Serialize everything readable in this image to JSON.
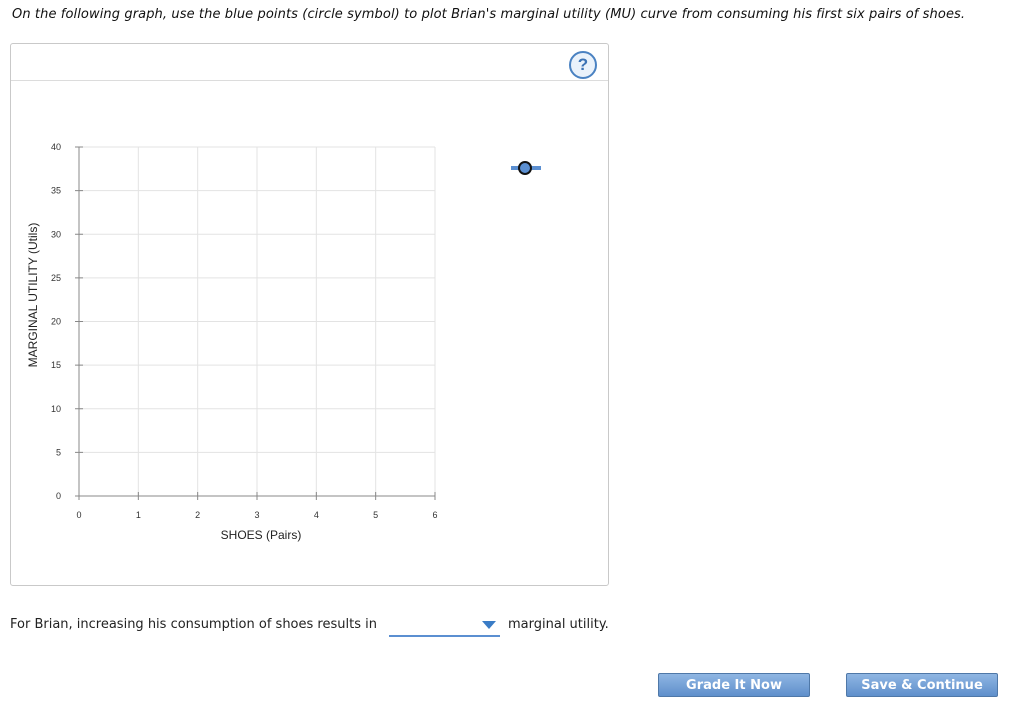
{
  "instruction": "On the following graph, use the blue points (circle symbol) to plot Brian's marginal utility (MU) curve from consuming his first six pairs of shoes.",
  "help_button": {
    "label": "?",
    "icon": "help-question-icon"
  },
  "palette": {
    "accent": "#3a7cc6",
    "point_fill": "#5b8fd1",
    "grid": "#e3e3e3",
    "axis": "#888888"
  },
  "chart_data": {
    "type": "scatter",
    "title": "",
    "xlabel": "SHOES (Pairs)",
    "ylabel": "MARGINAL UTILITY (Utils)",
    "xlim": [
      0,
      6
    ],
    "ylim": [
      0,
      40
    ],
    "x_ticks": [
      "0",
      "1",
      "2",
      "3",
      "4",
      "5",
      "6"
    ],
    "y_ticks": [
      "0",
      "5",
      "10",
      "15",
      "20",
      "25",
      "30",
      "35",
      "40"
    ],
    "grid": true,
    "series": [
      {
        "symbol": "circle",
        "color": "#5b8fd1",
        "points": []
      }
    ],
    "palette_tool": {
      "symbol": "circle",
      "location": "right of plot, top"
    }
  },
  "question": {
    "prefix": "For Brian, increasing his consumption of shoes results in",
    "dropdown_value": "",
    "suffix": "marginal utility."
  },
  "buttons": {
    "grade": "Grade It Now",
    "save": "Save & Continue"
  }
}
